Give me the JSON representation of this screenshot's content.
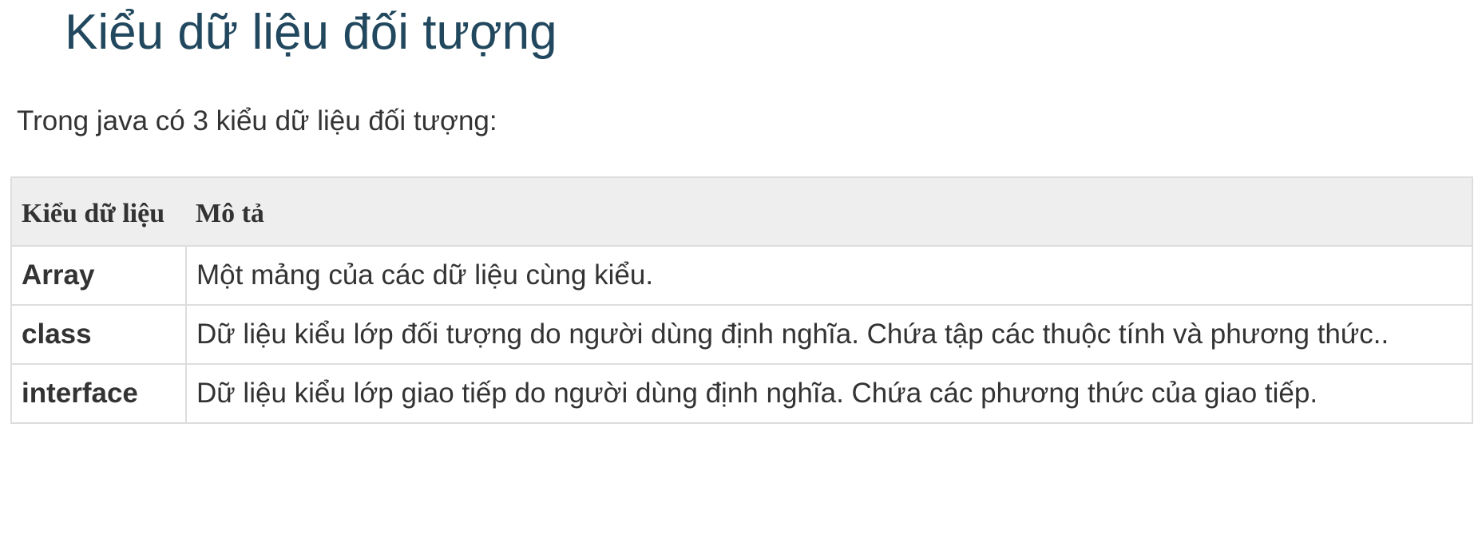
{
  "heading": "Kiểu dữ liệu đối tượng",
  "intro": "Trong java có 3 kiểu dữ liệu đối tượng:",
  "table": {
    "headers": [
      "Kiểu dữ liệu",
      "Mô tả"
    ],
    "rows": [
      {
        "type": "Array",
        "description": "Một mảng của các dữ liệu cùng kiểu."
      },
      {
        "type": "class",
        "description": "Dữ liệu kiểu lớp đối tượng do người dùng định nghĩa. Chứa tập các thuộc tính và phương thức.."
      },
      {
        "type": "interface",
        "description": "Dữ liệu kiểu lớp giao tiếp do người dùng định nghĩa. Chứa các phương thức của giao tiếp."
      }
    ]
  },
  "colors": {
    "heading": "#21485e",
    "text": "#333333",
    "header_bg": "#eeeeee",
    "border": "#dddddd"
  }
}
